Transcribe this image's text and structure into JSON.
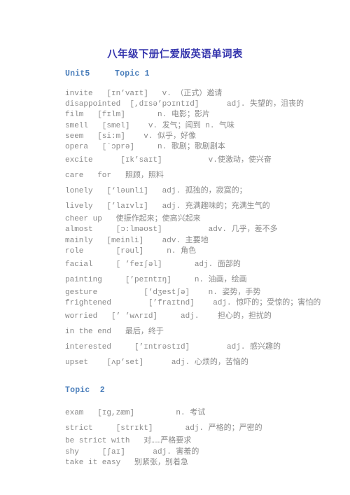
{
  "document": {
    "title": "八年级下册仁爱版英语单词表"
  },
  "sections": [
    {
      "heading": "Unit5     Topic 1",
      "entries": [
        {
          "text": "invite   [ɪn’vaɪt]   v. （正式）邀请",
          "spacing": "tight"
        },
        {
          "text": "disappointed  [,dɪsə’pɔɪntɪd]      adj. 失望的，沮丧的",
          "spacing": "tight"
        },
        {
          "text": "film   [fɪlm]       n. 电影；影片",
          "spacing": "tight"
        },
        {
          "text": "smell   [smel]    v. 发气；闻到 n. 气味",
          "spacing": "tight"
        },
        {
          "text": "seem   [si:m]    v. 似乎，好像",
          "spacing": "tight"
        },
        {
          "text": "opera   [`ɔprə]     n. 歌剧；歌剧剧本",
          "spacing": "tight"
        },
        {
          "text": "excite      [ɪk’saɪt]          v.使激动，使兴奋",
          "spacing": "loose"
        },
        {
          "text": "care   for   照顾，照料",
          "spacing": "loose"
        },
        {
          "text": "lonely   [‘ləunli]   adj. 孤独的，寂寞的；",
          "spacing": "loose"
        },
        {
          "text": "lively   [’laɪvlɪ]   adj. 充满趣味的；充满生气的",
          "spacing": "loose"
        },
        {
          "text": "cheer up   使振作起来；使高兴起来",
          "spacing": "tight"
        },
        {
          "text": "almost     [ɔ:lməʊst]          adv. 几乎，差不多",
          "spacing": "tight"
        },
        {
          "text": "mainly   [meinli]    adv. 主要地",
          "spacing": "tight"
        },
        {
          "text": "role       [rəul]     n. 角色",
          "spacing": "tight"
        },
        {
          "text": "facial     [ ’feɪʃəl]       adj. 面部的",
          "spacing": "loose"
        },
        {
          "text": "painting     [’peɪntɪŋ]     n. 油画，绘画",
          "spacing": "loose"
        },
        {
          "text": "gesture          [’dʒestʃə]    n. 姿势，手势",
          "spacing": "tight"
        },
        {
          "text": "frightened        [’fraɪtnd]    adj. 惊吓的；受惊的；害怕的",
          "spacing": "tight"
        },
        {
          "text": "worried   [’ ’wʌrɪd]     adj.    担心的，担扰的",
          "spacing": "loose"
        },
        {
          "text": "in the end   最后，终于",
          "spacing": "loose"
        },
        {
          "text": "interested     [’ɪntrəstɪd]        adj. 感兴趣的",
          "spacing": "loose"
        },
        {
          "text": "upset    [ʌp’set]      adj. 心烦的，苦恼的",
          "spacing": "loose"
        }
      ]
    },
    {
      "heading": "Topic  2",
      "entries": [
        {
          "text": "exam   [ɪg,zæm]         n. 考试",
          "spacing": "loose"
        },
        {
          "text": "strict     [strɪkt]       adj. 严格的；严密的",
          "spacing": "loose"
        },
        {
          "text": "be strict with   对……严格要求",
          "spacing": "tight"
        },
        {
          "text": "shy     [ʃaɪ]      adj. 害羞的",
          "spacing": "tight"
        },
        {
          "text": "take it easy   别紧张，别着急",
          "spacing": "tight"
        }
      ]
    }
  ],
  "colors": {
    "title": "#3434ad",
    "heading": "#4a7ebb",
    "body": "#8a8a8a",
    "background": "#ffffff"
  }
}
